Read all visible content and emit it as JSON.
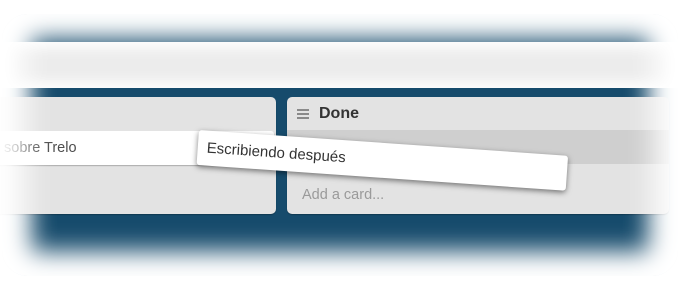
{
  "board": {
    "background_color": "#164b6c"
  },
  "lists": [
    {
      "title": "",
      "cards": [
        "sobre Trelo"
      ]
    },
    {
      "title": "Done",
      "icon": "list-menu-icon",
      "add_card_label": "Add a card..."
    }
  ],
  "dragging_card": {
    "text": "Escribiendo después"
  }
}
